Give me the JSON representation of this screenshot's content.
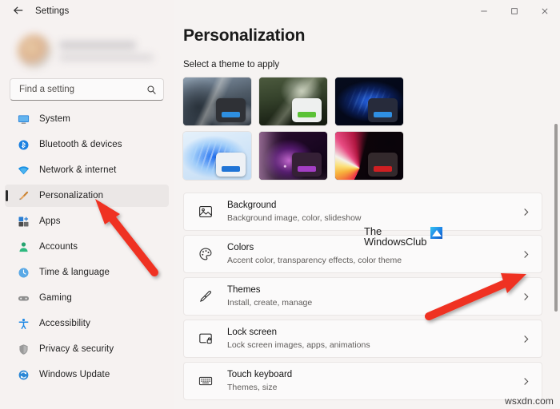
{
  "window": {
    "title": "Settings",
    "back_icon": "back-arrow-icon",
    "controls": {
      "minimize": "─",
      "maximize": "□",
      "close": "✕"
    }
  },
  "sidebar": {
    "profile": {
      "name_blurred": "",
      "email_blurred": ""
    },
    "search": {
      "placeholder": "Find a setting",
      "value": "",
      "icon": "search-icon"
    },
    "items": [
      {
        "label": "System",
        "icon": "monitor-icon",
        "selected": false
      },
      {
        "label": "Bluetooth & devices",
        "icon": "bluetooth-icon",
        "selected": false
      },
      {
        "label": "Network & internet",
        "icon": "wifi-icon",
        "selected": false
      },
      {
        "label": "Personalization",
        "icon": "paintbrush-icon",
        "selected": true
      },
      {
        "label": "Apps",
        "icon": "apps-icon",
        "selected": false
      },
      {
        "label": "Accounts",
        "icon": "person-icon",
        "selected": false
      },
      {
        "label": "Time & language",
        "icon": "clock-icon",
        "selected": false
      },
      {
        "label": "Gaming",
        "icon": "gamepad-icon",
        "selected": false
      },
      {
        "label": "Accessibility",
        "icon": "accessibility-icon",
        "selected": false
      },
      {
        "label": "Privacy & security",
        "icon": "shield-icon",
        "selected": false
      },
      {
        "label": "Windows Update",
        "icon": "update-icon",
        "selected": false
      }
    ]
  },
  "main": {
    "page_title": "Personalization",
    "theme_section_label": "Select a theme to apply",
    "themes": [
      {
        "name": "Glacier mountain theme",
        "wallpaper": "wp-mountain",
        "card_bg": "#2f3136",
        "accent": "#2e8fe0"
      },
      {
        "name": "Sunrise forest theme",
        "wallpaper": "wp-forest",
        "card_bg": "#eef0ef",
        "accent": "#5bc236"
      },
      {
        "name": "Windows dark bloom theme",
        "wallpaper": "wp-bloom-dark",
        "card_bg": "#272b3b",
        "accent": "#2f8fe3"
      },
      {
        "name": "Windows light bloom theme",
        "wallpaper": "wp-bloom-light",
        "card_bg": "#eef1f5",
        "accent": "#1f74d6"
      },
      {
        "name": "Purple glow theme",
        "wallpaper": "wp-purple",
        "card_bg": "#352036",
        "accent": "#a33ec4"
      },
      {
        "name": "Flow flower theme",
        "wallpaper": "wp-flower",
        "card_bg": "#33292c",
        "accent": "#d01f22"
      }
    ],
    "settings_rows": [
      {
        "title": "Background",
        "subtitle": "Background image, color, slideshow",
        "icon": "picture-icon",
        "chevron": "chevron-right-icon"
      },
      {
        "title": "Colors",
        "subtitle": "Accent color, transparency effects, color theme",
        "icon": "palette-icon",
        "chevron": "chevron-right-icon"
      },
      {
        "title": "Themes",
        "subtitle": "Install, create, manage",
        "icon": "paintbrush-icon",
        "chevron": "chevron-right-icon"
      },
      {
        "title": "Lock screen",
        "subtitle": "Lock screen images, apps, animations",
        "icon": "lock-screen-icon",
        "chevron": "chevron-right-icon"
      },
      {
        "title": "Touch keyboard",
        "subtitle": "Themes, size",
        "icon": "keyboard-icon",
        "chevron": "chevron-right-icon"
      }
    ]
  },
  "watermarks": {
    "windowsclub_line1": "The",
    "windowsclub_line2": "WindowsClub",
    "site": "wsxdn.com"
  },
  "annotations": {
    "arrow_color": "#ef3124",
    "arrow_left_target": "Personalization",
    "arrow_right_target": "Colors"
  }
}
